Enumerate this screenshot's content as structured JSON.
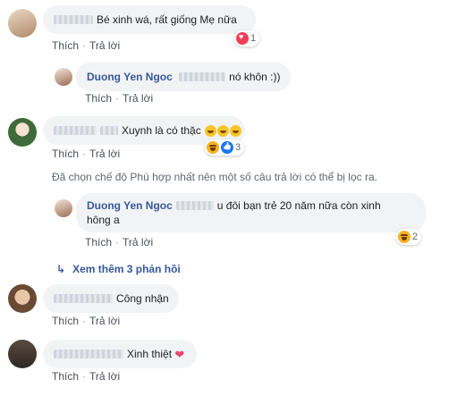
{
  "actions": {
    "like": "Thích",
    "reply": "Trả lời",
    "dot": "·"
  },
  "comments": [
    {
      "text": "Bé xinh wá, rất giống Mẹ nữa",
      "reaction_count": "1"
    },
    {
      "author": "Duong Yen Ngoc",
      "text": "nó khôn :))"
    },
    {
      "text": "Xuynh là có thặc",
      "reaction_count": "3"
    },
    {
      "author": "Duong Yen Ngoc",
      "text_line1": "u đôi bạn trẻ 20 năm nữa còn xinh",
      "text_line2": "hông a",
      "reaction_count": "2"
    },
    {
      "text": "Công nhận"
    },
    {
      "text": "Xinh thiệt"
    }
  ],
  "filter_notice": "Đã chọn chế độ Phù hợp nhất nên một số câu trả lời có thể bị lọc ra.",
  "see_more": "Xem thêm 3 phản hồi",
  "colors": {
    "link": "#385898",
    "bubble": "#f2f3f5",
    "heart": "#f33e58",
    "haha": "#f7b125",
    "like": "#1877f2"
  }
}
